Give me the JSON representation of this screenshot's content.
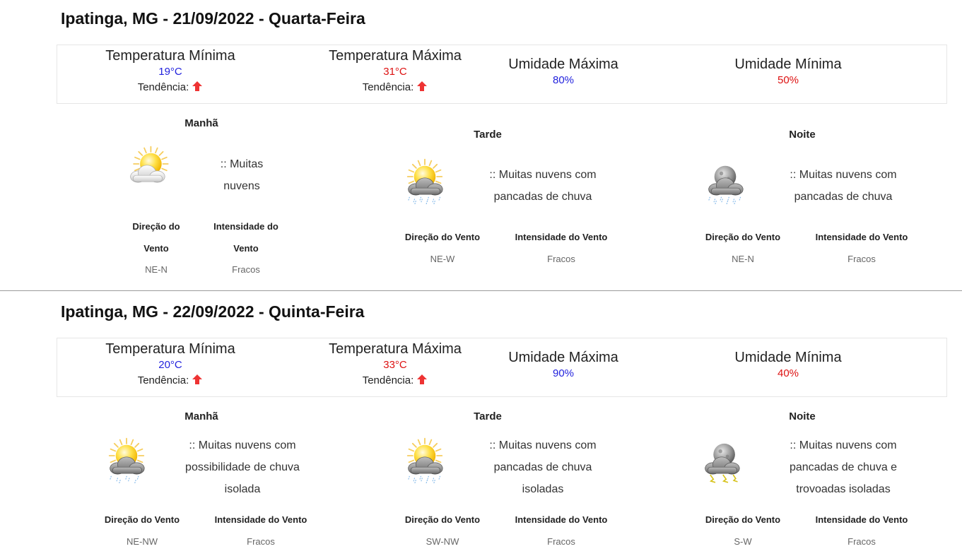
{
  "days": [
    {
      "title": "Ipatinga, MG - 21/09/2022 - Quarta-Feira",
      "summary": {
        "temp_min_label": "Temperatura Mínima",
        "temp_min": "19°C",
        "temp_min_trend_label": "Tendência:",
        "temp_max_label": "Temperatura Máxima",
        "temp_max": "31°C",
        "temp_max_trend_label": "Tendência:",
        "hum_max_label": "Umidade Máxima",
        "hum_max": "80%",
        "hum_min_label": "Umidade Mínima",
        "hum_min": "50%"
      },
      "periods": [
        {
          "name": "Manhã",
          "icon": "sun-cloud-icon",
          "condition_lines": [
            ":: Muitas",
            "nuvens"
          ],
          "wind_dir_label_lines": [
            "Direção do",
            "Vento"
          ],
          "wind_int_label_lines": [
            "Intensidade do",
            "Vento"
          ],
          "wind_dir": "NE-N",
          "wind_int": "Fracos"
        },
        {
          "name": "Tarde",
          "icon": "sun-rain-icon",
          "condition_lines": [
            ":: Muitas nuvens com",
            "pancadas de chuva"
          ],
          "wind_dir_label_lines": [
            "Direção do Vento"
          ],
          "wind_int_label_lines": [
            "Intensidade do Vento"
          ],
          "wind_dir": "NE-W",
          "wind_int": "Fracos"
        },
        {
          "name": "Noite",
          "icon": "moon-rain-icon",
          "condition_lines": [
            ":: Muitas nuvens com",
            "pancadas de chuva"
          ],
          "wind_dir_label_lines": [
            "Direção do Vento"
          ],
          "wind_int_label_lines": [
            "Intensidade do Vento"
          ],
          "wind_dir": "NE-N",
          "wind_int": "Fracos"
        }
      ]
    },
    {
      "title": "Ipatinga, MG - 22/09/2022 - Quinta-Feira",
      "summary": {
        "temp_min_label": "Temperatura Mínima",
        "temp_min": "20°C",
        "temp_min_trend_label": "Tendência:",
        "temp_max_label": "Temperatura Máxima",
        "temp_max": "33°C",
        "temp_max_trend_label": "Tendência:",
        "hum_max_label": "Umidade Máxima",
        "hum_max": "90%",
        "hum_min_label": "Umidade Mínima",
        "hum_min": "40%"
      },
      "periods": [
        {
          "name": "Manhã",
          "icon": "sun-light-rain-icon",
          "condition_lines": [
            ":: Muitas nuvens com",
            "possibilidade de chuva",
            "isolada"
          ],
          "wind_dir_label_lines": [
            "Direção do Vento"
          ],
          "wind_int_label_lines": [
            "Intensidade do Vento"
          ],
          "wind_dir": "NE-NW",
          "wind_int": "Fracos"
        },
        {
          "name": "Tarde",
          "icon": "sun-rain-icon",
          "condition_lines": [
            ":: Muitas nuvens com",
            "pancadas de chuva",
            "isoladas"
          ],
          "wind_dir_label_lines": [
            "Direção do Vento"
          ],
          "wind_int_label_lines": [
            "Intensidade do Vento"
          ],
          "wind_dir": "SW-NW",
          "wind_int": "Fracos"
        },
        {
          "name": "Noite",
          "icon": "moon-storm-icon",
          "condition_lines": [
            ":: Muitas nuvens com",
            "pancadas de chuva e",
            "trovoadas isoladas"
          ],
          "wind_dir_label_lines": [
            "Direção do Vento"
          ],
          "wind_int_label_lines": [
            "Intensidade do Vento"
          ],
          "wind_dir": "S-W",
          "wind_int": "Fracos"
        }
      ]
    }
  ],
  "colors": {
    "min_value": "#2222dd",
    "max_value": "#dd1111",
    "trend_arrow": "#ee3333"
  },
  "trend_icon": "arrow-up-icon"
}
